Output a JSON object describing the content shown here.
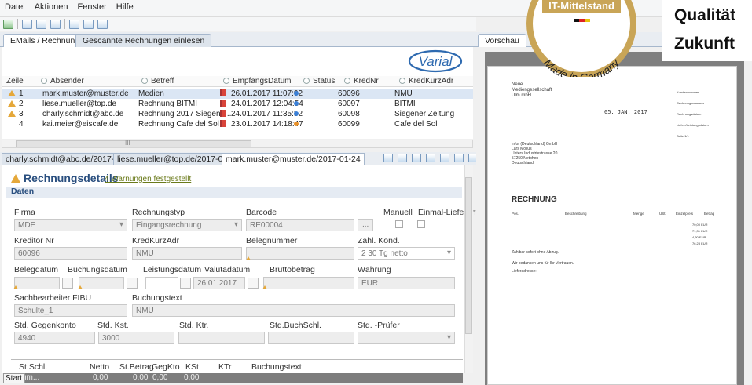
{
  "menu": [
    "Datei",
    "Aktionen",
    "Fenster",
    "Hilfe"
  ],
  "tabs_top": [
    "EMails / Rechnungen",
    "Gescannte Rechnungen einlesen"
  ],
  "logo": "Varial",
  "columns": [
    "Zeile",
    "Absender",
    "Betreff",
    "EmpfangsDatum",
    "Status",
    "KredNr",
    "KredKurzAdr"
  ],
  "rows": [
    {
      "zeile": "1",
      "absender": "mark.muster@muster.de",
      "betreff": "Medien",
      "datum": "26.01.2017 11:07:02",
      "status": "#3a7fd6",
      "krednr": "60096",
      "kurz": "NMU",
      "warn": true
    },
    {
      "zeile": "2",
      "absender": "liese.mueller@top.de",
      "betreff": "Rechnung BITMI",
      "datum": "24.01.2017 12:04:54",
      "status": "#3a7fd6",
      "krednr": "60097",
      "kurz": "BITMI",
      "warn": true
    },
    {
      "zeile": "3",
      "absender": "charly.schmidt@abc.de",
      "betreff": "Rechnung 2017 Siegene...",
      "datum": "24.01.2017 11:35:52",
      "status": "#3a7fd6",
      "krednr": "60098",
      "kurz": "Siegener Zeitung",
      "warn": true
    },
    {
      "zeile": "4",
      "absender": "kai.meier@eiscafe.de",
      "betreff": "Rechnung Cafe del Sol",
      "datum": "23.01.2017 14:18:47",
      "status": "#e8912a",
      "krednr": "60099",
      "kurz": "Cafe del Sol",
      "warn": false
    }
  ],
  "hscroll_label": "III",
  "doc_tabs": [
    "charly.schmidt@abc.de/2017-01-24",
    "liese.mueller@top.de/2017-01-24",
    "mark.muster@muster.de/2017-01-24"
  ],
  "details": {
    "title": "Rechnungsdetails",
    "warnings": "4 Warnungen festgestellt",
    "section": "Daten"
  },
  "form": {
    "firma_l": "Firma",
    "firma": "MDE",
    "rtyp_l": "Rechnungstyp",
    "rtyp": "Eingangsrechnung",
    "barcode_l": "Barcode",
    "barcode": "RE00004",
    "dots": "...",
    "manuell_l": "Manuell",
    "einmal_l": "Einmal-Lieferant",
    "kred_l": "Kreditor Nr",
    "kred": "60096",
    "kurz_l": "KredKurzAdr",
    "kurz": "NMU",
    "beleg_l": "Belegnummer",
    "zahl_l": "Zahl. Kond.",
    "zahl": "2 30 Tg netto",
    "belegdat_l": "Belegdatum",
    "buchdat_l": "Buchungsdatum",
    "leistdat_l": "Leistungsdatum",
    "valuta_l": "Valutadatum",
    "valuta": "26.01.2017",
    "brutto_l": "Bruttobetrag",
    "waehrung_l": "Währung",
    "waehrung": "EUR",
    "sach_l": "Sachbearbeiter FIBU",
    "sach": "Schulte_1",
    "btext_l": "Buchungstext",
    "btext": "NMU",
    "gegen_l": "Std. Gegenkonto",
    "gegen": "4940",
    "kst_l": "Std. Kst.",
    "kst": "3000",
    "ktr_l": "Std. Ktr.",
    "bschl_l": "Std.BuchSchl.",
    "pruef_l": "Std. -Prüfer"
  },
  "table": {
    "headers": [
      "St.Schl.",
      "Netto",
      "St.Betrag",
      "GegKto",
      "KSt",
      "KTr",
      "Buchungstext"
    ],
    "row": [
      "um...",
      "0,00",
      "0,00",
      "0,00",
      "0,00"
    ]
  },
  "start": "Start",
  "preview_tab": "Vorschau",
  "badge": {
    "line1": "IT-Mittelstand",
    "line2": "Made in Germany"
  },
  "slogan": [
    "Qualität",
    "Zukunft"
  ],
  "pdf": {
    "sender": [
      "Neue",
      "Mediengesellschaft",
      "Ulm mbH"
    ],
    "date": "05. JAN. 2017",
    "addr": [
      "Infor (Deutschland) GmbH",
      "Lars Mollus",
      "Unters Industriestrasse 20",
      "57250 Netphen",
      "Deutschland"
    ],
    "title": "RECHNUNG",
    "cols": [
      "Pos.",
      "Beschreibung",
      "Menge",
      "USt.",
      "Einzelpreis",
      "Betrag"
    ],
    "sum": [
      "70,00 EUR",
      "71,31 EUR",
      "4,30 EUR",
      "76,28 EUR"
    ],
    "text1": "Zahlbar sofort ohne Abzug.",
    "text2": "Wir bedanken uns für Ihr Vertrauen.",
    "text3": "Lieferadresse:",
    "side": [
      "Kundennummer",
      "Rechnungsnummer",
      "Rechnungsdatum",
      "Liefer-/Leistungsdatum",
      "Seite 1/1"
    ]
  }
}
